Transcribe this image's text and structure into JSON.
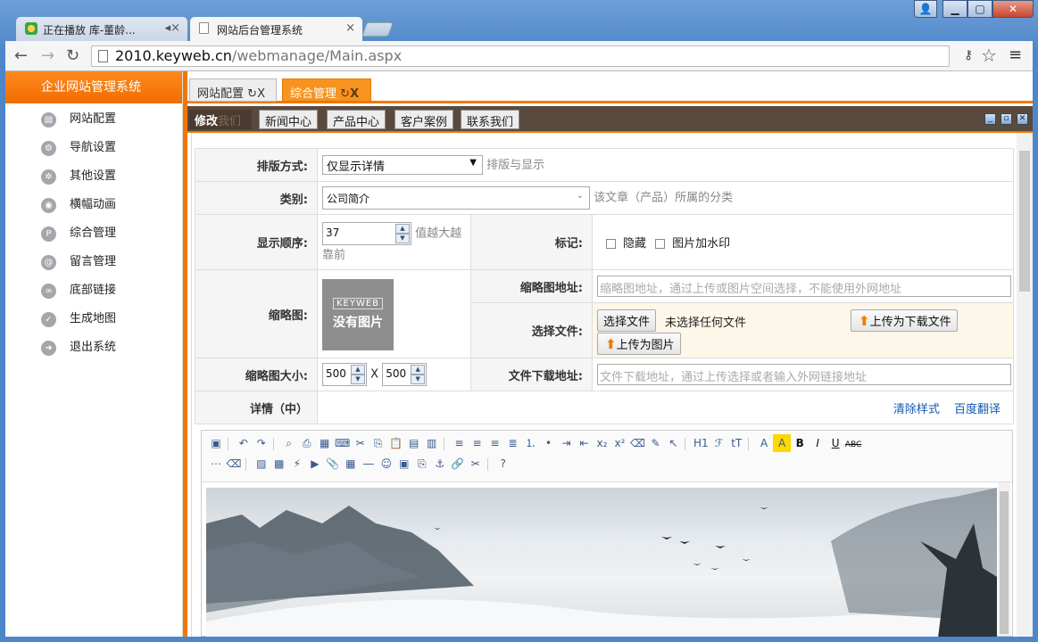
{
  "browser": {
    "tabs": [
      {
        "title": "正在播放 库-董龄..."
      },
      {
        "title": "网站后台管理系统"
      }
    ],
    "address": {
      "domain": "2010.keyweb.cn",
      "path": "/webmanage/Main.aspx"
    }
  },
  "sidebar": {
    "title": "企业网站管理系统",
    "items": [
      {
        "label": "网站配置",
        "icon": "config-icon"
      },
      {
        "label": "导航设置",
        "icon": "navigation-icon"
      },
      {
        "label": "其他设置",
        "icon": "gear-icon"
      },
      {
        "label": "横幅动画",
        "icon": "camera-icon"
      },
      {
        "label": "综合管理",
        "icon": "p-icon"
      },
      {
        "label": "留言管理",
        "icon": "at-icon"
      },
      {
        "label": "底部链接",
        "icon": "link-icon"
      },
      {
        "label": "生成地图",
        "icon": "check-icon"
      },
      {
        "label": "退出系统",
        "icon": "exit-icon"
      }
    ]
  },
  "page_tabs": [
    {
      "label": "网站配置",
      "close": "X"
    },
    {
      "label": "综合管理",
      "close": "X"
    }
  ],
  "panel": {
    "edit_label": "修改",
    "edit_sub": "我们",
    "buttons": [
      "新闻中心",
      "产品中心",
      "客户案例",
      "联系我们"
    ]
  },
  "form": {
    "layout_label": "排版方式:",
    "layout_value": "仅显示详情",
    "layout_hint": "排版与显示",
    "category_label": "类别:",
    "category_value": "公司简介",
    "category_hint": "该文章（产品）所属的分类",
    "order_label": "显示顺序:",
    "order_value": "37",
    "order_hint_1": "值越大越",
    "order_hint_2": "靠前",
    "mark_label": "标记:",
    "mark_hidden": "隐藏",
    "mark_watermark": "图片加水印",
    "thumb_label": "缩略图:",
    "thumb_brand": "KEYWEB",
    "thumb_none": "没有图片",
    "thumb_url_label": "缩略图地址:",
    "thumb_url_placeholder": "缩略图地址，通过上传或图片空间选择，不能使用外网地址",
    "choose_file_label": "选择文件:",
    "choose_file_button": "选择文件",
    "no_file_text": "未选择任何文件",
    "upload_download_button": "上传为下载文件",
    "upload_image_button": "上传为图片",
    "thumb_size_label": "缩略图大小:",
    "thumb_width": "500",
    "thumb_x": "X",
    "thumb_height": "500",
    "download_url_label": "文件下载地址:",
    "download_url_placeholder": "文件下载地址，通过上传选择或者输入外网链接地址",
    "detail_label": "详情（中）",
    "clear_style_link": "清除样式",
    "baidu_translate_link": "百度翻译"
  },
  "colors": {
    "accent": "#f07800",
    "panel_bar": "#5a4a3e",
    "link": "#1558b0"
  }
}
